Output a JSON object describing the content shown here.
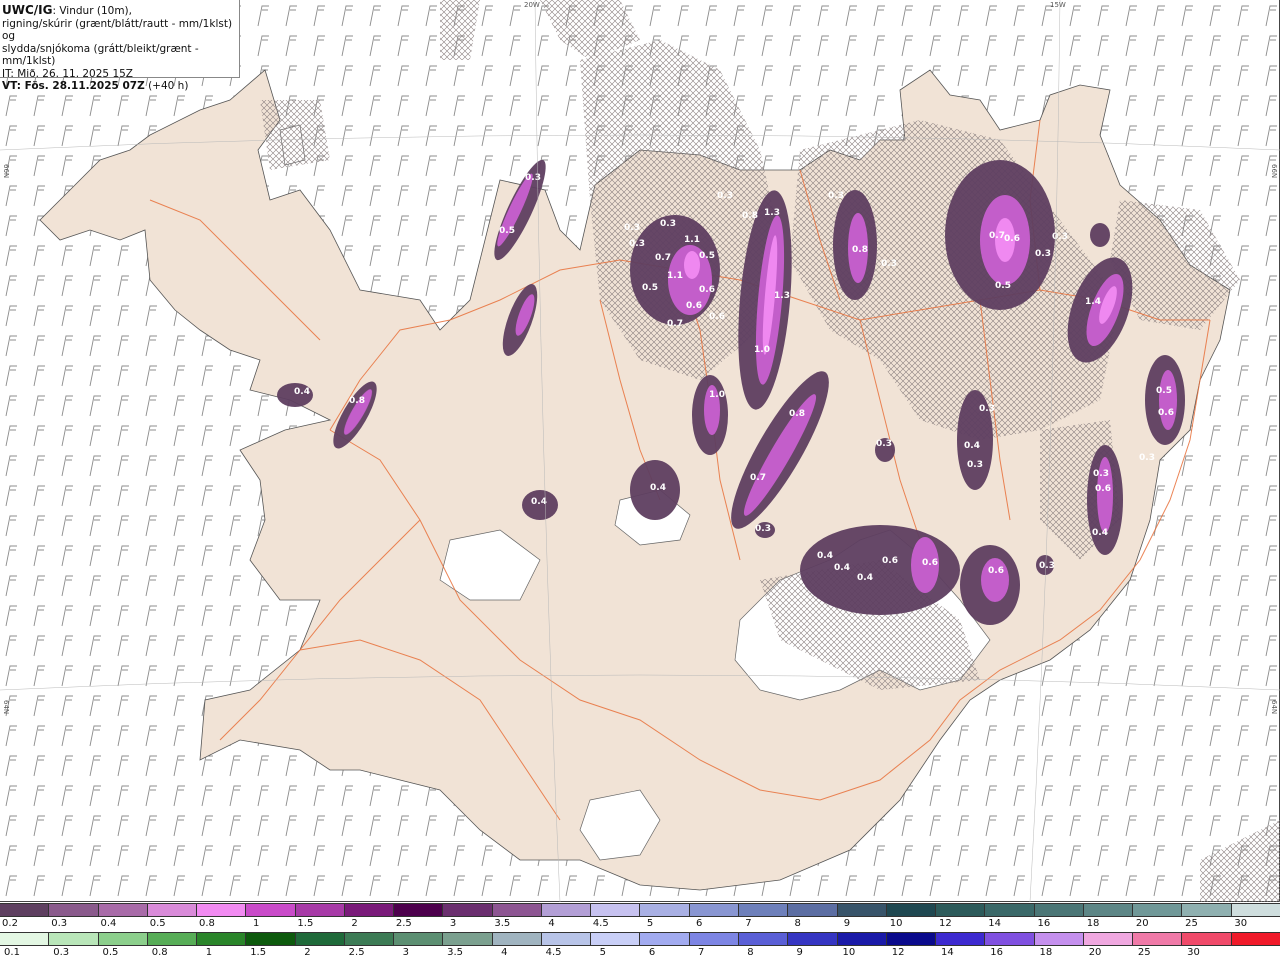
{
  "header": {
    "title_bold": "UWC/IG",
    "title_rest": ": Vindur (10m),",
    "line2": "rigning/skúrir (grænt/blátt/rautt - mm/1klst) og",
    "line3": "slydda/snjókoma (grátt/bleikt/grænt - mm/1klst)",
    "it_line": "IT: Mið. 26. 11. 2025 15Z",
    "vt_bold": "VT: Fös. 28.11.2025 07Z",
    "vt_rest": "(+40 h)"
  },
  "grid_labels": {
    "lon_20w": "20W",
    "lon_15w": "15W",
    "lat_66n_left": "66N",
    "lat_66n_right": "66N",
    "lat_64n_left": "64N",
    "lat_64n_right": "64N"
  },
  "colors": {
    "land": "#f1e3d6",
    "roads": "#e8703a",
    "glacier": "#ffffff",
    "snow_light": "#8c5a8c",
    "snow_mid": "#b44fc0",
    "snow_strong": "#ee77ee",
    "dark_purple": "#4a2a4e",
    "hatch": "#8a7f80",
    "wind_barb": "#888888"
  },
  "precip_labels": [
    "0.3",
    "0.5",
    "0.3",
    "0.3",
    "0.3",
    "0.5",
    "0.7",
    "1.1",
    "1.1",
    "0.5",
    "0.6",
    "0.6",
    "0.7",
    "0.6",
    "0.3",
    "0.8",
    "1.3",
    "0.3",
    "0.8",
    "0.3",
    "0.7",
    "0.6",
    "0.3",
    "0.3",
    "1.3",
    "0.5",
    "1.0",
    "1.4",
    "1.0",
    "0.5",
    "0.4",
    "0.8",
    "0.8",
    "0.3",
    "0.6",
    "0.3",
    "0.4",
    "0.3",
    "0.7",
    "0.4",
    "0.4",
    "0.3",
    "0.6",
    "0.6",
    "0.4",
    "0.3",
    "0.4",
    "0.4",
    "0.3",
    "0.6",
    "0.6",
    "0.4",
    "0.3"
  ],
  "snow_scale": {
    "labels": [
      "0.2",
      "0.3",
      "0.4",
      "0.5",
      "0.8",
      "1",
      "1.5",
      "2",
      "2.5",
      "3",
      "3.5",
      "4",
      "4.5",
      "5",
      "6",
      "7",
      "8",
      "9",
      "10",
      "12",
      "14",
      "16",
      "18",
      "20",
      "25",
      "30"
    ],
    "colors": [
      "#5e3f60",
      "#8a5a8c",
      "#a86ba8",
      "#d98bd9",
      "#f28bf2",
      "#c94bc9",
      "#a73aa7",
      "#7a1a7a",
      "#4d004d",
      "#6b2f6f",
      "#8d5592",
      "#b39fd6",
      "#c7c2f0",
      "#a9b0e4",
      "#8996d2",
      "#6e80bb",
      "#5c6ea3",
      "#38546a",
      "#1f4851",
      "#2d5b5b",
      "#3b6969",
      "#4b7676",
      "#5d8686",
      "#709898",
      "#8fb0b0",
      "#cfdede"
    ]
  },
  "rain_scale": {
    "labels": [
      "0.1",
      "0.3",
      "0.5",
      "0.8",
      "1",
      "1.5",
      "2",
      "2.5",
      "3",
      "3.5",
      "4",
      "4.5",
      "5",
      "6",
      "7",
      "8",
      "9",
      "10",
      "12",
      "14",
      "16",
      "18",
      "20",
      "25",
      "30"
    ],
    "colors": [
      "#e3f7e3",
      "#b9e6b9",
      "#8ccf8c",
      "#57ad57",
      "#2a852a",
      "#0d5a0d",
      "#1f6a3a",
      "#3c7b55",
      "#5c8f72",
      "#7ba08f",
      "#a0b4c0",
      "#b8c4e8",
      "#c9cff7",
      "#a2abf0",
      "#7d85e4",
      "#5a5fd6",
      "#3535c2",
      "#1a1aa8",
      "#0a0a8c",
      "#3d2ad0",
      "#8050e0",
      "#c590ee",
      "#f0a8e0",
      "#f07aa8",
      "#f04a6a",
      "#f01a2a"
    ]
  }
}
